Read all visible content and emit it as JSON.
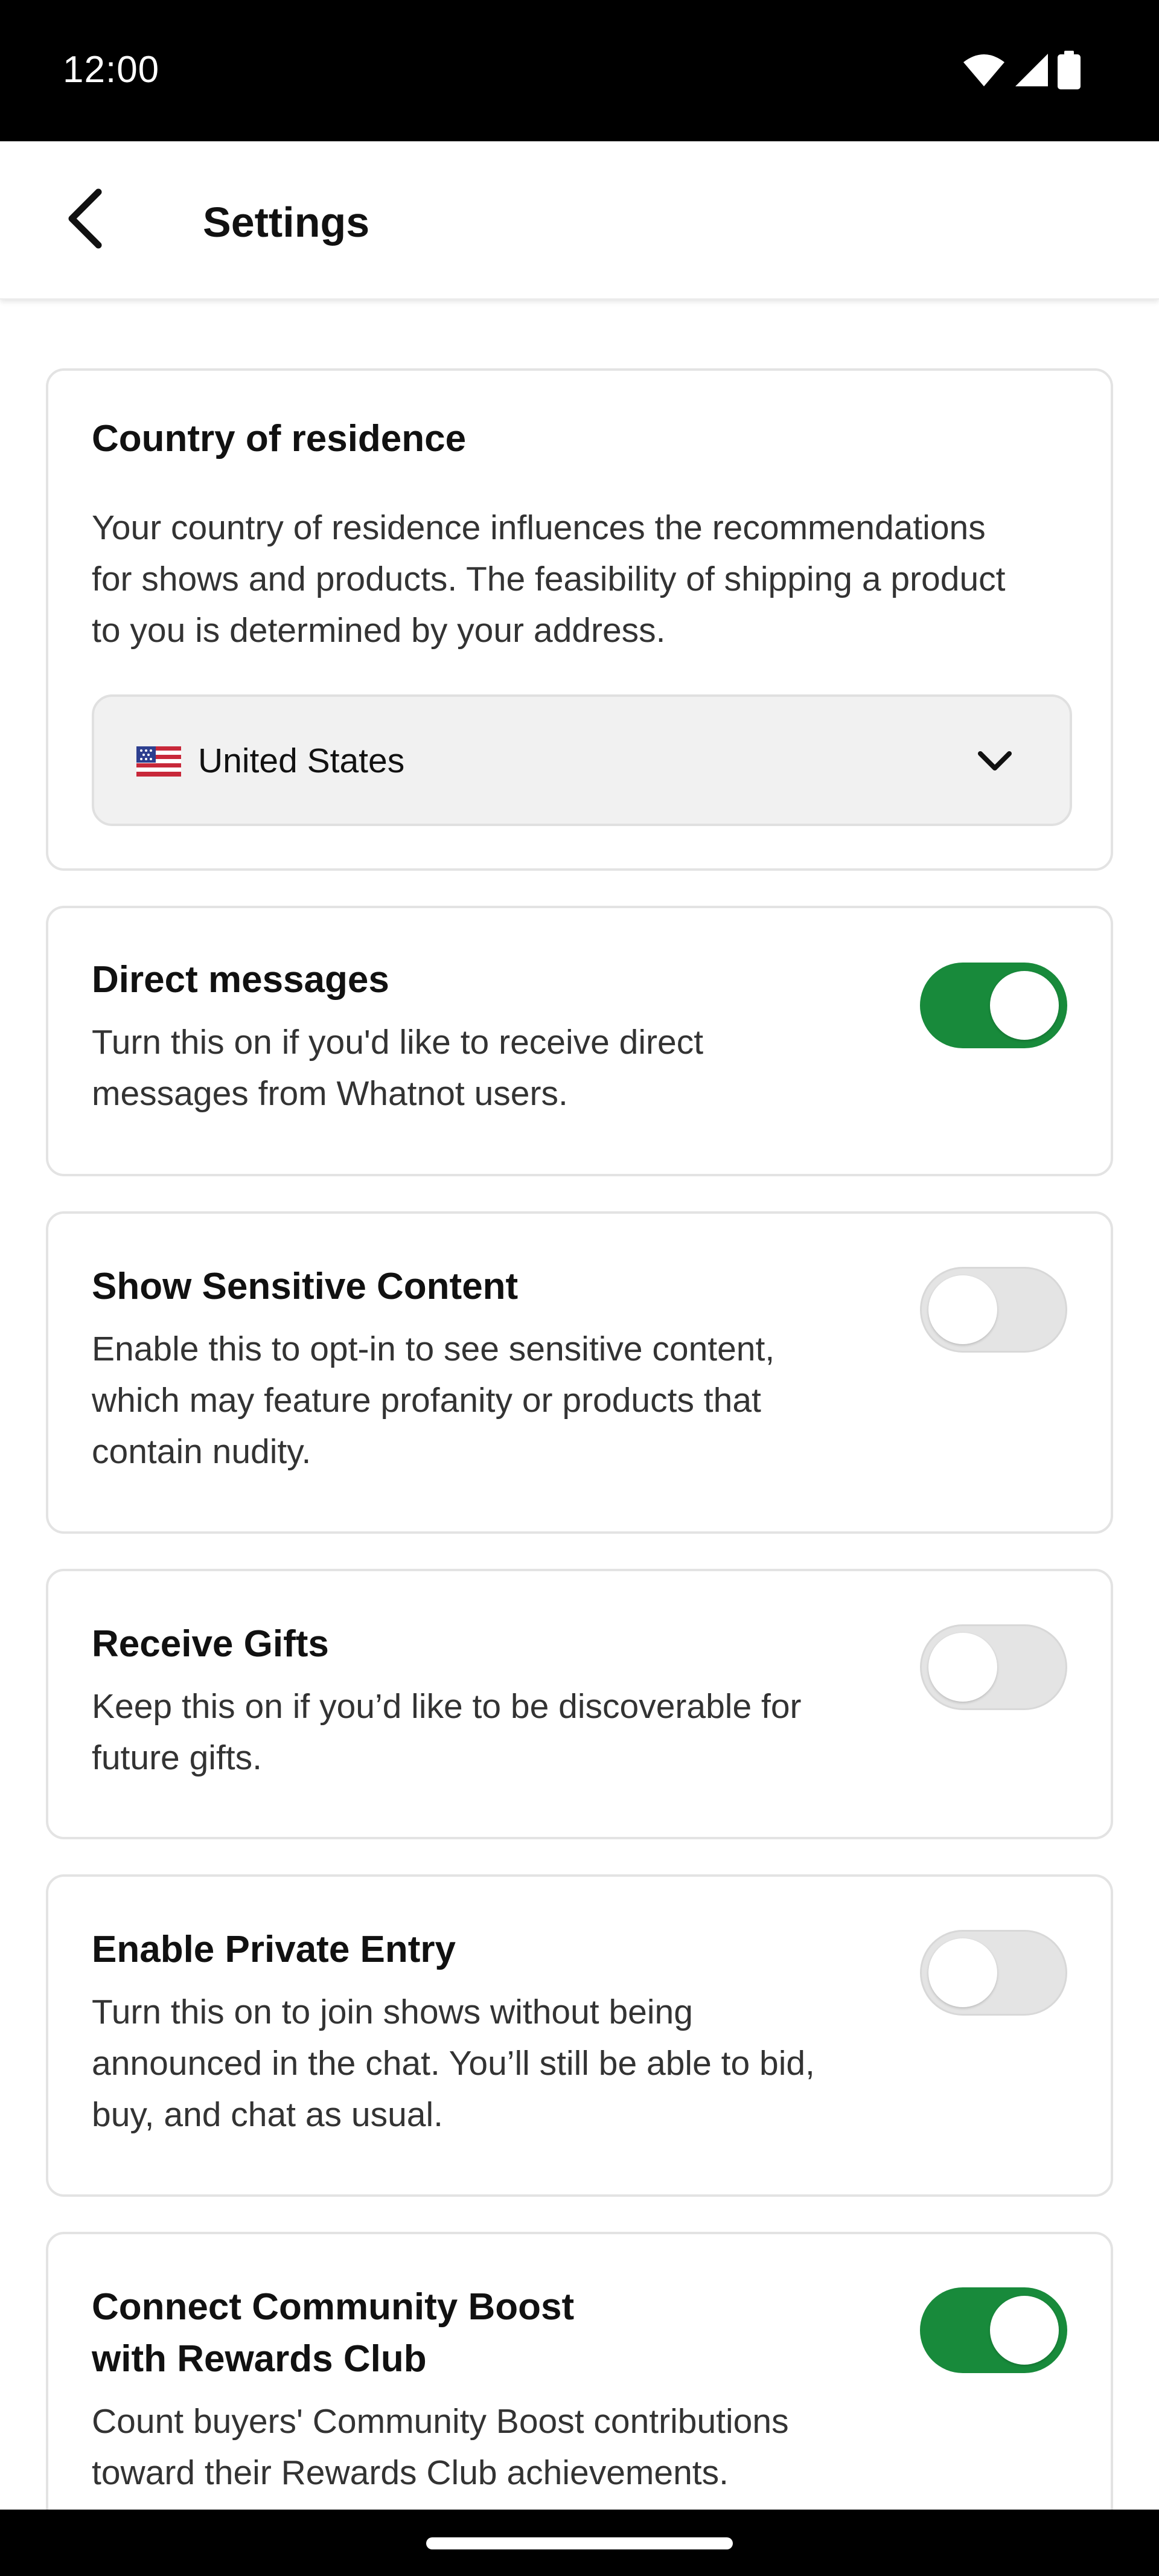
{
  "status_bar": {
    "time": "12:00",
    "icons": [
      "wifi-icon",
      "signal-icon",
      "battery-icon"
    ]
  },
  "app_bar": {
    "back_icon": "chevron-left-icon",
    "title": "Settings"
  },
  "country_card": {
    "title": "Country of residence",
    "description_lines": [
      "Your country of residence influences the recommendations",
      "for shows and products. The feasibility of shipping a product",
      "to you is determined by your address."
    ],
    "selected_country": "United States",
    "flag_icon": "us-flag-icon",
    "dropdown_icon": "chevron-down-icon"
  },
  "settings": [
    {
      "title_lines": [
        "Direct messages"
      ],
      "description_lines": [
        "Turn this on if you'd like to receive direct",
        "messages from Whatnot users."
      ],
      "enabled": true
    },
    {
      "title_lines": [
        "Show Sensitive Content"
      ],
      "description_lines": [
        "Enable this to opt-in to see sensitive content,",
        "which may feature profanity or products that",
        "contain nudity."
      ],
      "enabled": false
    },
    {
      "title_lines": [
        "Receive Gifts"
      ],
      "description_lines": [
        "Keep this on if you’d like to be discoverable for",
        "future gifts."
      ],
      "enabled": false
    },
    {
      "title_lines": [
        "Enable Private Entry"
      ],
      "description_lines": [
        "Turn this on to join shows without being",
        "announced in the chat. You’ll still be able to bid,",
        "buy, and chat as usual."
      ],
      "enabled": false
    },
    {
      "title_lines": [
        "Connect Community Boost",
        "with Rewards Club"
      ],
      "description_lines": [
        "Count buyers' Community Boost contributions",
        "toward their Rewards Club achievements."
      ],
      "enabled": true
    }
  ],
  "colors": {
    "toggle_on": "#188a3b",
    "toggle_off": "#e4e4e4",
    "card_border": "#e3e3e3",
    "select_background": "#f1f1f1"
  }
}
